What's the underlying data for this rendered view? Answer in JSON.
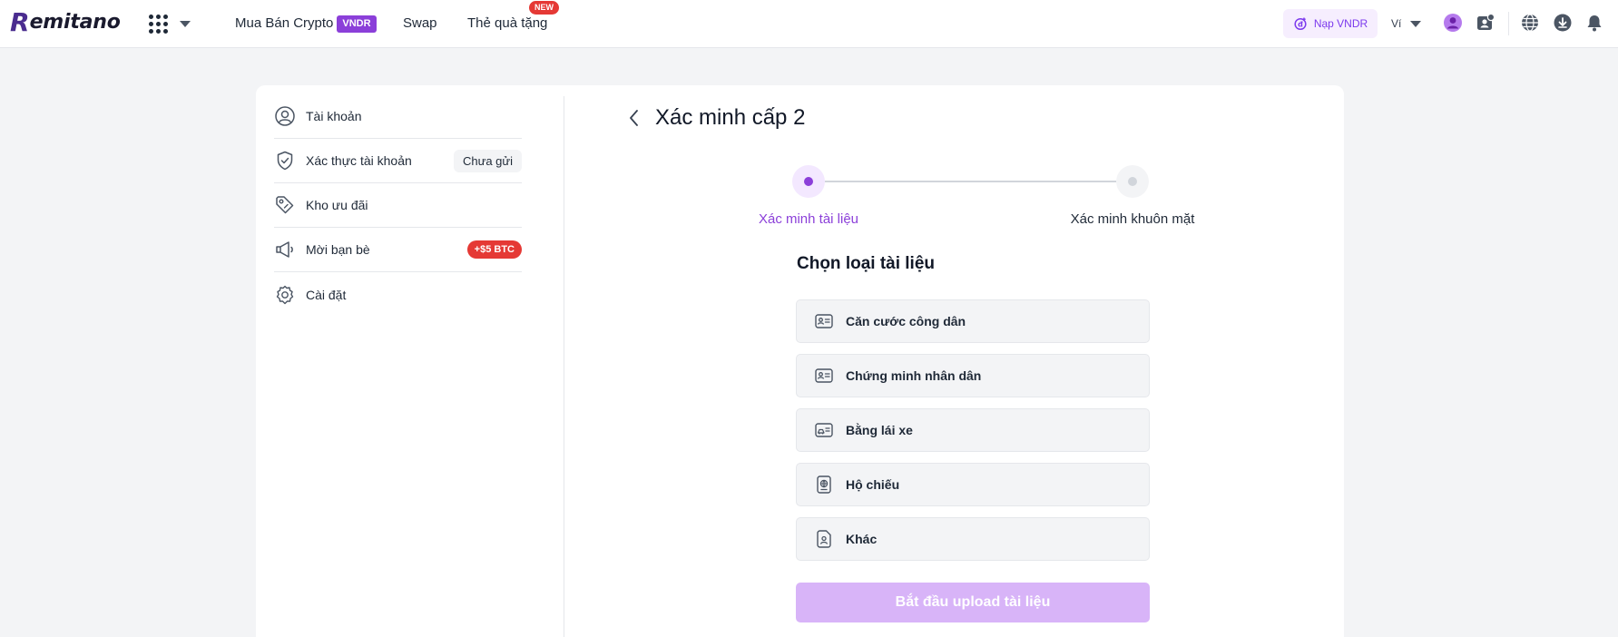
{
  "header": {
    "logo_mark": "R",
    "logo_text": "emitano",
    "nav": {
      "buy_crypto": "Mua Bán Crypto",
      "vndr_badge": "VNDR",
      "swap": "Swap",
      "gift_card": "Thẻ quà tặng",
      "new_badge": "NEW"
    },
    "deposit_label": "Nạp VNDR",
    "wallet_label": "Ví"
  },
  "sidebar": {
    "items": [
      {
        "label": "Tài khoản",
        "icon": "user-icon"
      },
      {
        "label": "Xác thực tài khoản",
        "icon": "shield-check-icon",
        "badge": "Chưa gửi"
      },
      {
        "label": "Kho ưu đãi",
        "icon": "tag-icon"
      },
      {
        "label": "Mời bạn bè",
        "icon": "megaphone-icon",
        "badge": "+$5 BTC"
      },
      {
        "label": "Cài đặt",
        "icon": "gear-icon"
      }
    ]
  },
  "main": {
    "title": "Xác minh cấp 2",
    "steps": [
      {
        "label": "Xác minh tài liệu",
        "active": true
      },
      {
        "label": "Xác minh khuôn mặt",
        "active": false
      }
    ],
    "section_title": "Chọn loại tài liệu",
    "documents": [
      {
        "label": "Căn cước công dân",
        "icon": "id-card-icon"
      },
      {
        "label": "Chứng minh nhân dân",
        "icon": "id-card-icon"
      },
      {
        "label": "Bằng lái xe",
        "icon": "driver-license-icon"
      },
      {
        "label": "Hộ chiếu",
        "icon": "passport-icon"
      },
      {
        "label": "Khác",
        "icon": "document-icon"
      }
    ],
    "start_button": "Bắt đầu upload tài liệu"
  },
  "colors": {
    "accent": "#8b3fd9",
    "accent_light": "#d8b4f8",
    "badge_red": "#e53935",
    "background": "#f3f4f6"
  }
}
